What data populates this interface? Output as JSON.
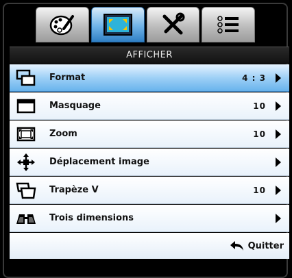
{
  "tabs": [
    {
      "icon": "palette-icon",
      "active": false
    },
    {
      "icon": "display-icon",
      "active": true
    },
    {
      "icon": "tools-icon",
      "active": false
    },
    {
      "icon": "list-icon",
      "active": false
    }
  ],
  "title": "AFFICHER",
  "items": [
    {
      "icon": "format-icon",
      "label": "Format",
      "value": "4 : 3",
      "has_arrow": true,
      "selected": true
    },
    {
      "icon": "masking-icon",
      "label": "Masquage",
      "value": "10",
      "has_arrow": true,
      "selected": false
    },
    {
      "icon": "zoom-icon",
      "label": "Zoom",
      "value": "10",
      "has_arrow": true,
      "selected": false
    },
    {
      "icon": "move-icon",
      "label": "Déplacement image",
      "value": "",
      "has_arrow": true,
      "selected": false
    },
    {
      "icon": "keystone-icon",
      "label": "Trapèze V",
      "value": "10",
      "has_arrow": true,
      "selected": false
    },
    {
      "icon": "3d-glasses-icon",
      "label": "Trois dimensions",
      "value": "",
      "has_arrow": true,
      "selected": false
    }
  ],
  "footer": {
    "quit_label": "Quitter",
    "icon": "back-arrow-icon"
  },
  "colors": {
    "selected_row": "#68b3ec",
    "active_tab": "#2f7fc4",
    "background": "#000000"
  }
}
